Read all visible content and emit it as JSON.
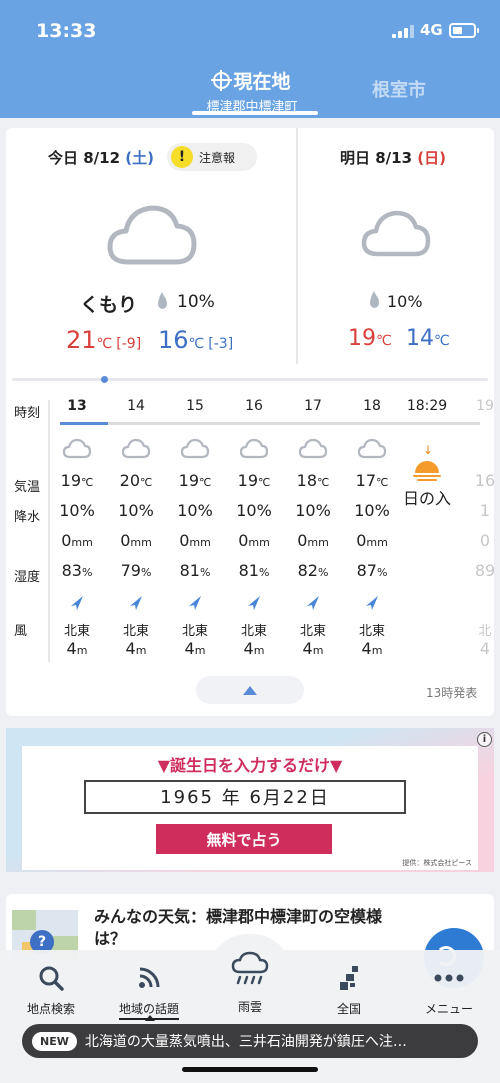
{
  "status_bar": {
    "time": "13:33",
    "network": "4G"
  },
  "header": {
    "location_tab": {
      "title": "現在地",
      "subtitle": "標津郡中標津町"
    },
    "city_tab": "根室市"
  },
  "today": {
    "label": "今日",
    "date": "8/12",
    "weekday": "(土)",
    "alert": "注意報",
    "alert_symbol": "!",
    "icon": "cloud-icon",
    "condition": "くもり",
    "pop": "10%",
    "high": "21",
    "high_unit": "℃",
    "high_diff": "[-9]",
    "low": "16",
    "low_unit": "℃",
    "low_diff": "[-3]"
  },
  "tomorrow": {
    "label": "明日",
    "date": "8/13",
    "weekday": "(日)",
    "icon": "cloud-icon",
    "pop": "10%",
    "high": "19",
    "high_unit": "℃",
    "low": "14",
    "low_unit": "℃"
  },
  "hourly": {
    "row_labels": {
      "time": "時刻",
      "temp": "気温",
      "precip_prob": "降水",
      "humidity": "湿度",
      "wind": "風"
    },
    "hours": [
      {
        "hour": "13",
        "temp": "19",
        "temp_unit": "℃",
        "pop": "10%",
        "amount": "0",
        "amount_unit": "mm",
        "humidity": "83",
        "humidity_unit": "%",
        "wind_dir": "北東",
        "wind_speed": "4",
        "wind_unit": "m"
      },
      {
        "hour": "14",
        "temp": "20",
        "temp_unit": "℃",
        "pop": "10%",
        "amount": "0",
        "amount_unit": "mm",
        "humidity": "79",
        "humidity_unit": "%",
        "wind_dir": "北東",
        "wind_speed": "4",
        "wind_unit": "m"
      },
      {
        "hour": "15",
        "temp": "19",
        "temp_unit": "℃",
        "pop": "10%",
        "amount": "0",
        "amount_unit": "mm",
        "humidity": "81",
        "humidity_unit": "%",
        "wind_dir": "北東",
        "wind_speed": "4",
        "wind_unit": "m"
      },
      {
        "hour": "16",
        "temp": "19",
        "temp_unit": "℃",
        "pop": "10%",
        "amount": "0",
        "amount_unit": "mm",
        "humidity": "81",
        "humidity_unit": "%",
        "wind_dir": "北東",
        "wind_speed": "4",
        "wind_unit": "m"
      },
      {
        "hour": "17",
        "temp": "18",
        "temp_unit": "℃",
        "pop": "10%",
        "amount": "0",
        "amount_unit": "mm",
        "humidity": "82",
        "humidity_unit": "%",
        "wind_dir": "北東",
        "wind_speed": "4",
        "wind_unit": "m"
      },
      {
        "hour": "18",
        "temp": "17",
        "temp_unit": "℃",
        "pop": "10%",
        "amount": "0",
        "amount_unit": "mm",
        "humidity": "87",
        "humidity_unit": "%",
        "wind_dir": "北東",
        "wind_speed": "4",
        "wind_unit": "m"
      }
    ],
    "sunset": {
      "time": "18:29",
      "label": "日の入"
    },
    "next": {
      "hour": "19",
      "temp": "16",
      "pop": "1",
      "amount": "0",
      "humidity": "89",
      "wind_dir": "北",
      "wind_speed": "4"
    },
    "issued": "13時発表"
  },
  "ad": {
    "title": "▼誕生日を入力するだけ▼",
    "year": "1965",
    "year_unit": "年",
    "month": "6",
    "month_unit": "月",
    "day": "22",
    "day_unit": "日",
    "button": "無料で占う",
    "credit": "提供：株式会社ピース",
    "info_symbol": "i"
  },
  "article": {
    "title": "みんなの天気：標津郡中標津町の空模様は？",
    "help_symbol": "?"
  },
  "bottom_nav": [
    {
      "label": "地点検索",
      "icon": "search-icon"
    },
    {
      "label": "地域の話題",
      "icon": "rss-icon",
      "active": true
    },
    {
      "label": "雨雲",
      "icon": "rain-cloud-icon"
    },
    {
      "label": "全国",
      "icon": "map-icon"
    },
    {
      "label": "メニュー",
      "icon": "more-icon"
    }
  ],
  "news": {
    "badge": "NEW",
    "text": "北海道の大量蒸気噴出、三井石油開発が鎮圧へ注…"
  },
  "colors": {
    "header_blue": "#6aa3e3",
    "high_red": "#d8403a",
    "low_blue": "#3d6fc4",
    "ad_pink": "#cf2d5c",
    "alert_yellow": "#f5dd2a"
  }
}
